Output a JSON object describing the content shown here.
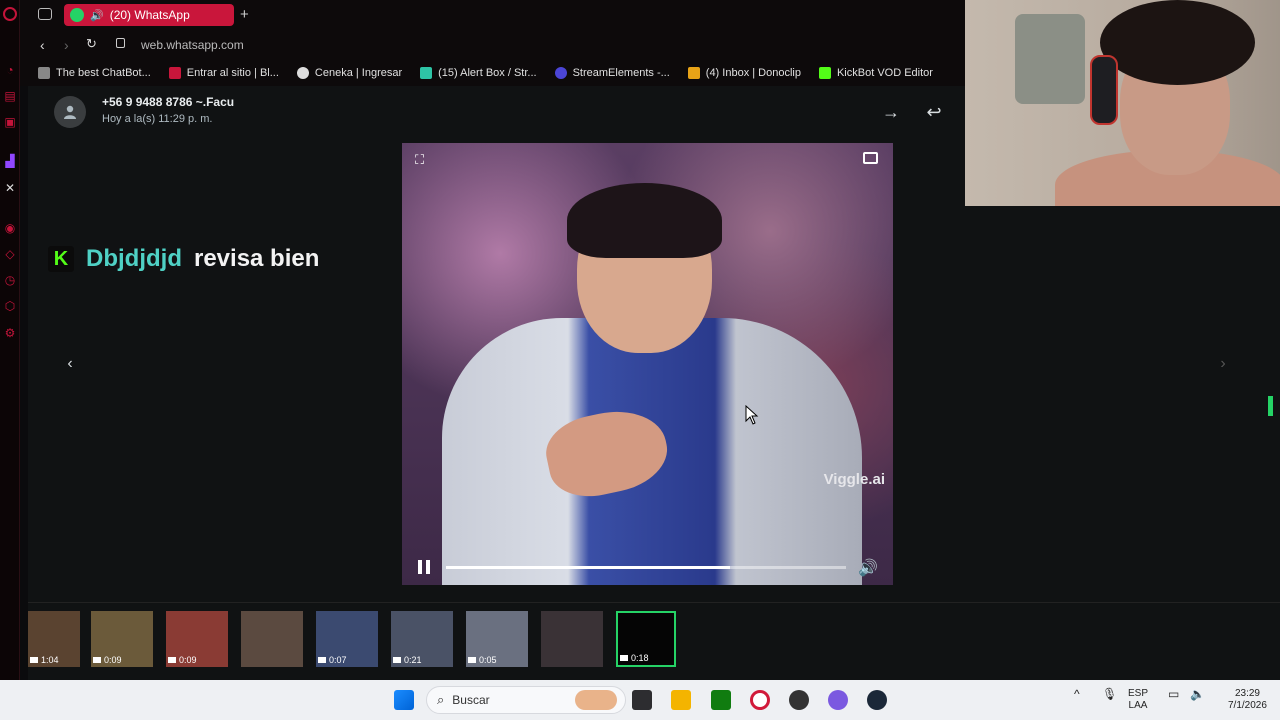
{
  "browser": {
    "tab_title": "(20) WhatsApp",
    "url": "web.whatsapp.com",
    "bookmarks": [
      {
        "label": "The best ChatBot...",
        "color": "#888888"
      },
      {
        "label": "Entrar al sitio | Bl...",
        "color": "#c9163b"
      },
      {
        "label": "Ceneka | Ingresar",
        "color": "#dddddd"
      },
      {
        "label": "(15) Alert Box / Str...",
        "color": "#2ec4a6"
      },
      {
        "label": "StreamElements -...",
        "color": "#4b45d6"
      },
      {
        "label": "(4) Inbox | Donoclip",
        "color": "#e8a317"
      },
      {
        "label": "KickBot VOD Editor",
        "color": "#53fc18"
      }
    ]
  },
  "viewer": {
    "contact": "+56 9 9488 8786 ~.Facu",
    "timestamp": "Hoy a la(s) 11:29 p. m.",
    "watermark": "Viggle.ai",
    "progress": 0.71,
    "thumbnails": [
      {
        "duration": "1:04",
        "color": "#5a4330"
      },
      {
        "duration": "0:09",
        "color": "#6b5a3a"
      },
      {
        "duration": "0:09",
        "color": "#8a3b34"
      },
      {
        "duration": "",
        "color": "#5b4a40"
      },
      {
        "duration": "0:07",
        "color": "#3b4a70"
      },
      {
        "duration": "0:21",
        "color": "#4a5266"
      },
      {
        "duration": "0:05",
        "color": "#6a7080"
      },
      {
        "duration": "",
        "color": "#3a3236"
      },
      {
        "duration": "0:18",
        "color": "#050505",
        "selected": true
      }
    ]
  },
  "chat_overlay": {
    "username": "Dbjdjdjd",
    "message": "revisa bien",
    "username_color": "#4fd1c5"
  },
  "taskbar": {
    "search_placeholder": "Buscar",
    "lang_top": "ESP",
    "lang_bottom": "LAA",
    "time": "23:29",
    "date": "7/1/2026"
  }
}
